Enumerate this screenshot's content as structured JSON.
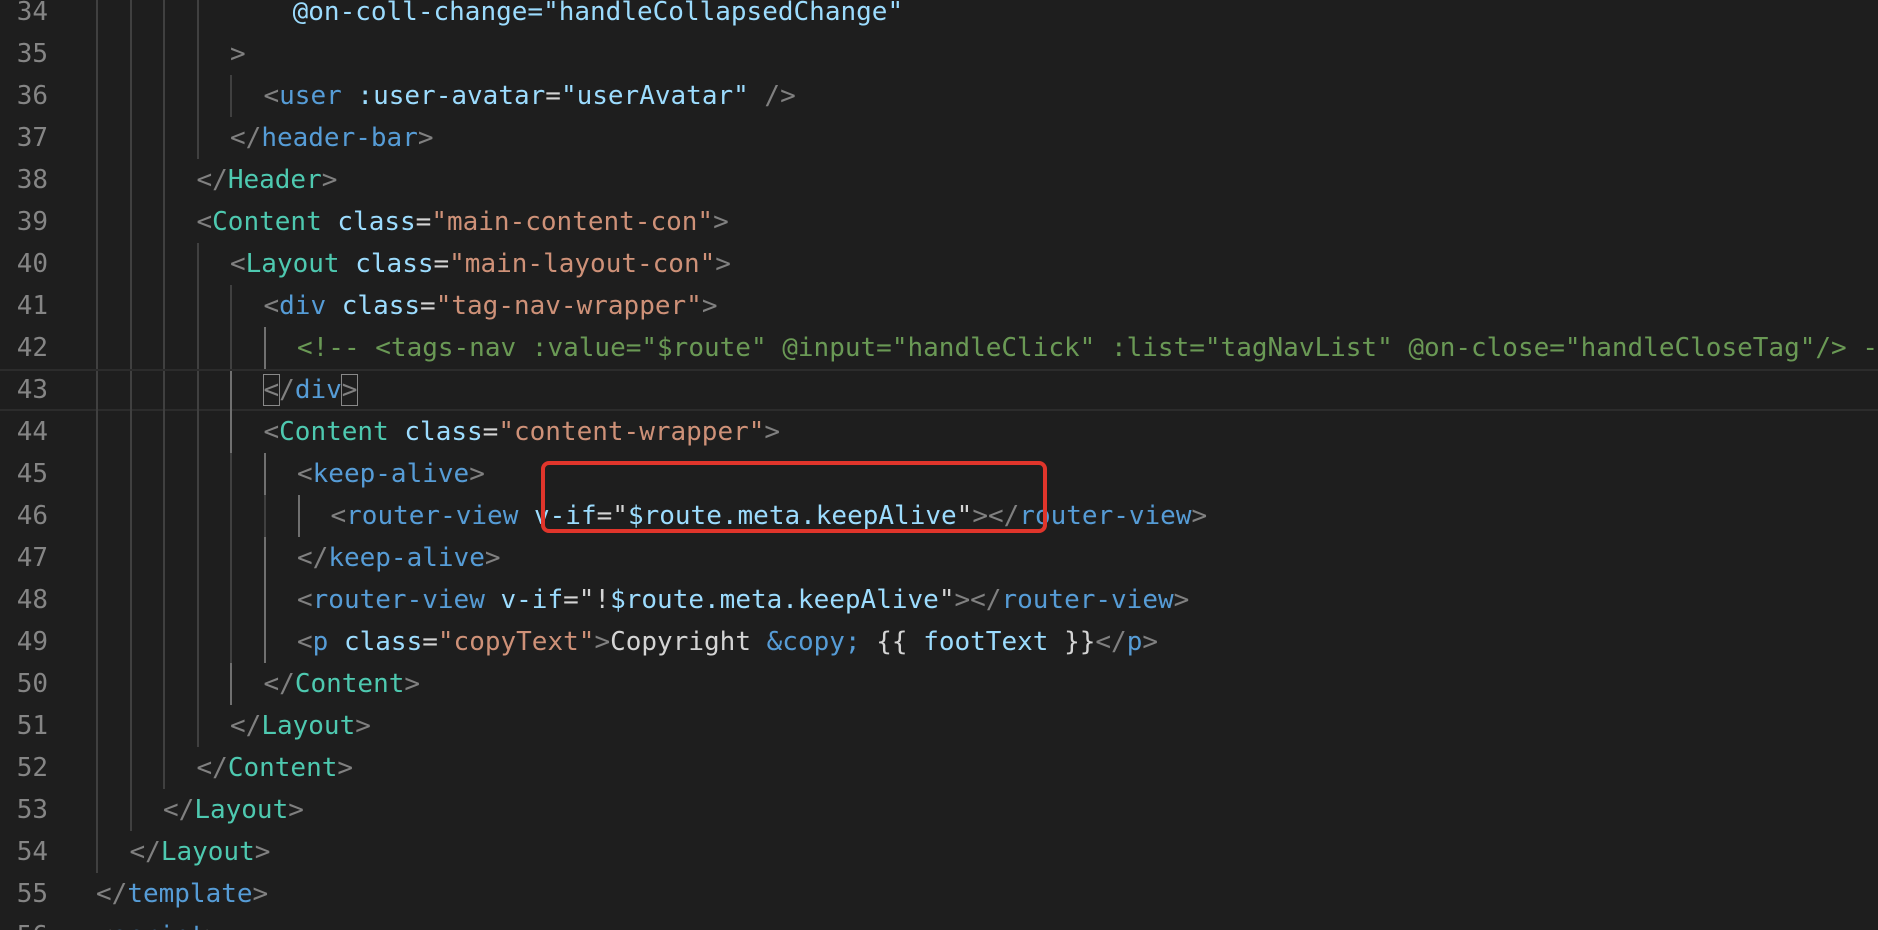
{
  "lines": [
    {
      "num": "34",
      "tokens": [
        {
          "t": "    @on-coll-change=\"handleCollapsedChange\"",
          "c": "t-attr"
        }
      ]
    },
    {
      "num": "35",
      "tokens": [
        {
          "t": ">",
          "c": "t-punc"
        }
      ]
    },
    {
      "num": "36",
      "tokens": [
        {
          "t": "<",
          "c": "t-punc"
        },
        {
          "t": "user",
          "c": "t-tag"
        },
        {
          "t": " :user-avatar",
          "c": "t-attr"
        },
        {
          "t": "=",
          "c": "t-text"
        },
        {
          "t": "\"userAvatar\"",
          "c": "t-attr"
        },
        {
          "t": " />",
          "c": "t-punc"
        }
      ]
    },
    {
      "num": "37",
      "tokens": [
        {
          "t": "</",
          "c": "t-punc"
        },
        {
          "t": "header-bar",
          "c": "t-tag"
        },
        {
          "t": ">",
          "c": "t-punc"
        }
      ]
    },
    {
      "num": "38",
      "tokens": [
        {
          "t": "</",
          "c": "t-punc"
        },
        {
          "t": "Header",
          "c": "t-comp"
        },
        {
          "t": ">",
          "c": "t-punc"
        }
      ]
    },
    {
      "num": "39",
      "tokens": [
        {
          "t": "<",
          "c": "t-punc"
        },
        {
          "t": "Content",
          "c": "t-comp"
        },
        {
          "t": " class",
          "c": "t-attr"
        },
        {
          "t": "=",
          "c": "t-text"
        },
        {
          "t": "\"main-content-con\"",
          "c": "t-str"
        },
        {
          "t": ">",
          "c": "t-punc"
        }
      ]
    },
    {
      "num": "40",
      "tokens": [
        {
          "t": "<",
          "c": "t-punc"
        },
        {
          "t": "Layout",
          "c": "t-comp"
        },
        {
          "t": " class",
          "c": "t-attr"
        },
        {
          "t": "=",
          "c": "t-text"
        },
        {
          "t": "\"main-layout-con\"",
          "c": "t-str"
        },
        {
          "t": ">",
          "c": "t-punc"
        }
      ]
    },
    {
      "num": "41",
      "tokens": [
        {
          "t": "<",
          "c": "t-punc"
        },
        {
          "t": "div",
          "c": "t-tag"
        },
        {
          "t": " class",
          "c": "t-attr"
        },
        {
          "t": "=",
          "c": "t-text"
        },
        {
          "t": "\"tag-nav-wrapper\"",
          "c": "t-str"
        },
        {
          "t": ">",
          "c": "t-punc"
        }
      ]
    },
    {
      "num": "42",
      "tokens": [
        {
          "t": "<!-- <tags-nav :value=\"$route\" @input=\"handleClick\" :list=\"tagNavList\" @on-close=\"handleCloseTag\"/> -->",
          "c": "t-comment"
        }
      ]
    },
    {
      "num": "43",
      "tokens": [
        {
          "t": "<",
          "c": "t-punc bracket-box"
        },
        {
          "t": "/",
          "c": "t-punc"
        },
        {
          "t": "div",
          "c": "t-tag"
        },
        {
          "t": ">",
          "c": "t-punc bracket-box"
        }
      ]
    },
    {
      "num": "44",
      "tokens": [
        {
          "t": "<",
          "c": "t-punc"
        },
        {
          "t": "Content",
          "c": "t-comp"
        },
        {
          "t": " class",
          "c": "t-attr"
        },
        {
          "t": "=",
          "c": "t-text"
        },
        {
          "t": "\"content-wrapper\"",
          "c": "t-str"
        },
        {
          "t": ">",
          "c": "t-punc"
        }
      ]
    },
    {
      "num": "45",
      "tokens": [
        {
          "t": "<",
          "c": "t-punc"
        },
        {
          "t": "keep-alive",
          "c": "t-tag"
        },
        {
          "t": ">",
          "c": "t-punc"
        }
      ]
    },
    {
      "num": "46",
      "tokens": [
        {
          "t": "<",
          "c": "t-punc"
        },
        {
          "t": "router-view",
          "c": "t-tag"
        },
        {
          "t": " v-if",
          "c": "t-attr"
        },
        {
          "t": "=",
          "c": "t-text"
        },
        {
          "t": "\"",
          "c": "t-text"
        },
        {
          "t": "$route.meta.keepAlive",
          "c": "t-attr"
        },
        {
          "t": "\"",
          "c": "t-text"
        },
        {
          "t": "></",
          "c": "t-punc"
        },
        {
          "t": "router-view",
          "c": "t-tag"
        },
        {
          "t": ">",
          "c": "t-punc"
        }
      ]
    },
    {
      "num": "47",
      "tokens": [
        {
          "t": "</",
          "c": "t-punc"
        },
        {
          "t": "keep-alive",
          "c": "t-tag"
        },
        {
          "t": ">",
          "c": "t-punc"
        }
      ]
    },
    {
      "num": "48",
      "tokens": [
        {
          "t": "<",
          "c": "t-punc"
        },
        {
          "t": "router-view",
          "c": "t-tag"
        },
        {
          "t": " v-if",
          "c": "t-attr"
        },
        {
          "t": "=",
          "c": "t-text"
        },
        {
          "t": "\"!",
          "c": "t-text"
        },
        {
          "t": "$route.meta.keepAlive",
          "c": "t-attr"
        },
        {
          "t": "\"",
          "c": "t-text"
        },
        {
          "t": "></",
          "c": "t-punc"
        },
        {
          "t": "router-view",
          "c": "t-tag"
        },
        {
          "t": ">",
          "c": "t-punc"
        }
      ]
    },
    {
      "num": "49",
      "tokens": [
        {
          "t": "<",
          "c": "t-punc"
        },
        {
          "t": "p",
          "c": "t-tag"
        },
        {
          "t": " class",
          "c": "t-attr"
        },
        {
          "t": "=",
          "c": "t-text"
        },
        {
          "t": "\"copyText\"",
          "c": "t-str"
        },
        {
          "t": ">",
          "c": "t-punc"
        },
        {
          "t": "Copyright ",
          "c": "t-text"
        },
        {
          "t": "&copy;",
          "c": "t-ent"
        },
        {
          "t": " {{ ",
          "c": "t-text"
        },
        {
          "t": "footText",
          "c": "t-attr"
        },
        {
          "t": " }}",
          "c": "t-text"
        },
        {
          "t": "</",
          "c": "t-punc"
        },
        {
          "t": "p",
          "c": "t-tag"
        },
        {
          "t": ">",
          "c": "t-punc"
        }
      ]
    },
    {
      "num": "50",
      "tokens": [
        {
          "t": "</",
          "c": "t-punc"
        },
        {
          "t": "Content",
          "c": "t-comp"
        },
        {
          "t": ">",
          "c": "t-punc"
        }
      ]
    },
    {
      "num": "51",
      "tokens": [
        {
          "t": "</",
          "c": "t-punc"
        },
        {
          "t": "Layout",
          "c": "t-comp"
        },
        {
          "t": ">",
          "c": "t-punc"
        }
      ]
    },
    {
      "num": "52",
      "tokens": [
        {
          "t": "</",
          "c": "t-punc"
        },
        {
          "t": "Content",
          "c": "t-comp"
        },
        {
          "t": ">",
          "c": "t-punc"
        }
      ]
    },
    {
      "num": "53",
      "tokens": [
        {
          "t": "</",
          "c": "t-punc"
        },
        {
          "t": "Layout",
          "c": "t-comp"
        },
        {
          "t": ">",
          "c": "t-punc"
        }
      ]
    },
    {
      "num": "54",
      "tokens": [
        {
          "t": "</",
          "c": "t-punc"
        },
        {
          "t": "Layout",
          "c": "t-comp"
        },
        {
          "t": ">",
          "c": "t-punc"
        }
      ]
    },
    {
      "num": "55",
      "tokens": [
        {
          "t": "</",
          "c": "t-punc"
        },
        {
          "t": "template",
          "c": "t-tag"
        },
        {
          "t": ">",
          "c": "t-punc"
        }
      ]
    },
    {
      "num": "56",
      "tokens": [
        {
          "t": "<",
          "c": "t-punc"
        },
        {
          "t": "script",
          "c": "t-tag"
        },
        {
          "t": ">",
          "c": "t-punc"
        }
      ]
    }
  ],
  "annotation_color": "#e0352b"
}
